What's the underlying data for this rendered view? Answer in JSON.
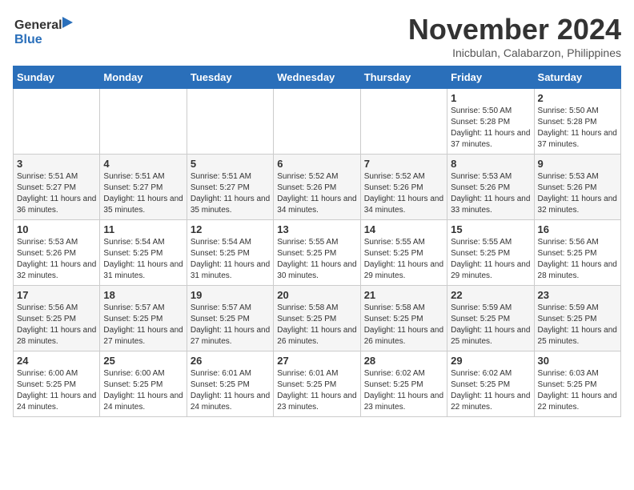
{
  "header": {
    "logo_general": "General",
    "logo_blue": "Blue",
    "month_year": "November 2024",
    "location": "Inicbulan, Calabarzon, Philippines"
  },
  "days_of_week": [
    "Sunday",
    "Monday",
    "Tuesday",
    "Wednesday",
    "Thursday",
    "Friday",
    "Saturday"
  ],
  "weeks": [
    [
      {
        "day": "",
        "info": ""
      },
      {
        "day": "",
        "info": ""
      },
      {
        "day": "",
        "info": ""
      },
      {
        "day": "",
        "info": ""
      },
      {
        "day": "",
        "info": ""
      },
      {
        "day": "1",
        "info": "Sunrise: 5:50 AM\nSunset: 5:28 PM\nDaylight: 11 hours and 37 minutes."
      },
      {
        "day": "2",
        "info": "Sunrise: 5:50 AM\nSunset: 5:28 PM\nDaylight: 11 hours and 37 minutes."
      }
    ],
    [
      {
        "day": "3",
        "info": "Sunrise: 5:51 AM\nSunset: 5:27 PM\nDaylight: 11 hours and 36 minutes."
      },
      {
        "day": "4",
        "info": "Sunrise: 5:51 AM\nSunset: 5:27 PM\nDaylight: 11 hours and 35 minutes."
      },
      {
        "day": "5",
        "info": "Sunrise: 5:51 AM\nSunset: 5:27 PM\nDaylight: 11 hours and 35 minutes."
      },
      {
        "day": "6",
        "info": "Sunrise: 5:52 AM\nSunset: 5:26 PM\nDaylight: 11 hours and 34 minutes."
      },
      {
        "day": "7",
        "info": "Sunrise: 5:52 AM\nSunset: 5:26 PM\nDaylight: 11 hours and 34 minutes."
      },
      {
        "day": "8",
        "info": "Sunrise: 5:53 AM\nSunset: 5:26 PM\nDaylight: 11 hours and 33 minutes."
      },
      {
        "day": "9",
        "info": "Sunrise: 5:53 AM\nSunset: 5:26 PM\nDaylight: 11 hours and 32 minutes."
      }
    ],
    [
      {
        "day": "10",
        "info": "Sunrise: 5:53 AM\nSunset: 5:26 PM\nDaylight: 11 hours and 32 minutes."
      },
      {
        "day": "11",
        "info": "Sunrise: 5:54 AM\nSunset: 5:25 PM\nDaylight: 11 hours and 31 minutes."
      },
      {
        "day": "12",
        "info": "Sunrise: 5:54 AM\nSunset: 5:25 PM\nDaylight: 11 hours and 31 minutes."
      },
      {
        "day": "13",
        "info": "Sunrise: 5:55 AM\nSunset: 5:25 PM\nDaylight: 11 hours and 30 minutes."
      },
      {
        "day": "14",
        "info": "Sunrise: 5:55 AM\nSunset: 5:25 PM\nDaylight: 11 hours and 29 minutes."
      },
      {
        "day": "15",
        "info": "Sunrise: 5:55 AM\nSunset: 5:25 PM\nDaylight: 11 hours and 29 minutes."
      },
      {
        "day": "16",
        "info": "Sunrise: 5:56 AM\nSunset: 5:25 PM\nDaylight: 11 hours and 28 minutes."
      }
    ],
    [
      {
        "day": "17",
        "info": "Sunrise: 5:56 AM\nSunset: 5:25 PM\nDaylight: 11 hours and 28 minutes."
      },
      {
        "day": "18",
        "info": "Sunrise: 5:57 AM\nSunset: 5:25 PM\nDaylight: 11 hours and 27 minutes."
      },
      {
        "day": "19",
        "info": "Sunrise: 5:57 AM\nSunset: 5:25 PM\nDaylight: 11 hours and 27 minutes."
      },
      {
        "day": "20",
        "info": "Sunrise: 5:58 AM\nSunset: 5:25 PM\nDaylight: 11 hours and 26 minutes."
      },
      {
        "day": "21",
        "info": "Sunrise: 5:58 AM\nSunset: 5:25 PM\nDaylight: 11 hours and 26 minutes."
      },
      {
        "day": "22",
        "info": "Sunrise: 5:59 AM\nSunset: 5:25 PM\nDaylight: 11 hours and 25 minutes."
      },
      {
        "day": "23",
        "info": "Sunrise: 5:59 AM\nSunset: 5:25 PM\nDaylight: 11 hours and 25 minutes."
      }
    ],
    [
      {
        "day": "24",
        "info": "Sunrise: 6:00 AM\nSunset: 5:25 PM\nDaylight: 11 hours and 24 minutes."
      },
      {
        "day": "25",
        "info": "Sunrise: 6:00 AM\nSunset: 5:25 PM\nDaylight: 11 hours and 24 minutes."
      },
      {
        "day": "26",
        "info": "Sunrise: 6:01 AM\nSunset: 5:25 PM\nDaylight: 11 hours and 24 minutes."
      },
      {
        "day": "27",
        "info": "Sunrise: 6:01 AM\nSunset: 5:25 PM\nDaylight: 11 hours and 23 minutes."
      },
      {
        "day": "28",
        "info": "Sunrise: 6:02 AM\nSunset: 5:25 PM\nDaylight: 11 hours and 23 minutes."
      },
      {
        "day": "29",
        "info": "Sunrise: 6:02 AM\nSunset: 5:25 PM\nDaylight: 11 hours and 22 minutes."
      },
      {
        "day": "30",
        "info": "Sunrise: 6:03 AM\nSunset: 5:25 PM\nDaylight: 11 hours and 22 minutes."
      }
    ]
  ]
}
